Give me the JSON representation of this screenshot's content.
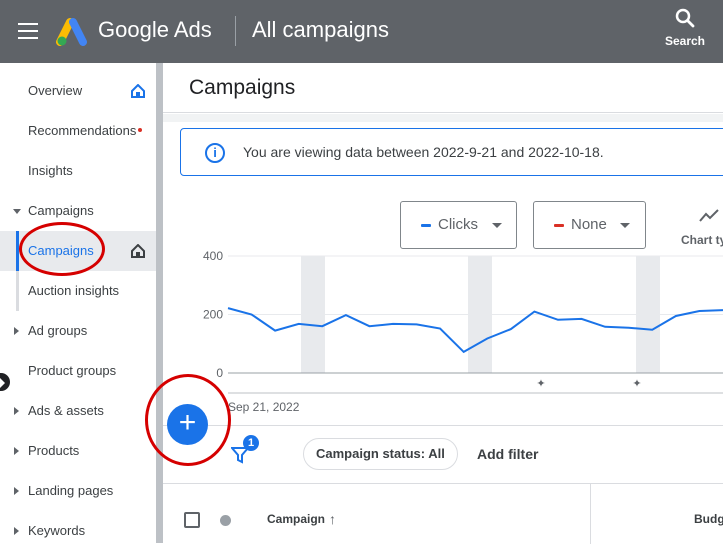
{
  "header": {
    "brand": "Google Ads",
    "page_title": "All campaigns",
    "search_label": "Search"
  },
  "sidebar": {
    "items": [
      {
        "label": "Overview"
      },
      {
        "label": "Recommendations"
      },
      {
        "label": "Insights"
      },
      {
        "label": "Campaigns"
      },
      {
        "label": "Campaigns"
      },
      {
        "label": "Auction insights"
      },
      {
        "label": "Ad groups"
      },
      {
        "label": "Product groups"
      },
      {
        "label": "Ads & assets"
      },
      {
        "label": "Products"
      },
      {
        "label": "Landing pages"
      },
      {
        "label": "Keywords"
      }
    ]
  },
  "main": {
    "title": "Campaigns",
    "info_text": "You are viewing data between 2022-9-21 and 2022-10-18.",
    "metric1": {
      "label": "Clicks",
      "color": "#1a73e8"
    },
    "metric2": {
      "label": "None",
      "color": "#d93025"
    },
    "chart_type_label": "Chart ty",
    "filter_badge": "1",
    "status_chip": "Campaign status: All",
    "add_filter": "Add filter",
    "table": {
      "col_campaign": "Campaign",
      "col_budget": "Budg"
    }
  },
  "chart_data": {
    "type": "line",
    "xlabel": "",
    "ylabel": "",
    "ylim": [
      0,
      400
    ],
    "y_ticks": [
      "400",
      "200",
      "0"
    ],
    "x_start_label": "Sep 21, 2022",
    "series": [
      {
        "color": "#1a73e8",
        "values": [
          222,
          200,
          145,
          168,
          160,
          198,
          160,
          168,
          166,
          152,
          72,
          118,
          150,
          210,
          182,
          185,
          158,
          155,
          148,
          195,
          212,
          215
        ]
      }
    ]
  }
}
